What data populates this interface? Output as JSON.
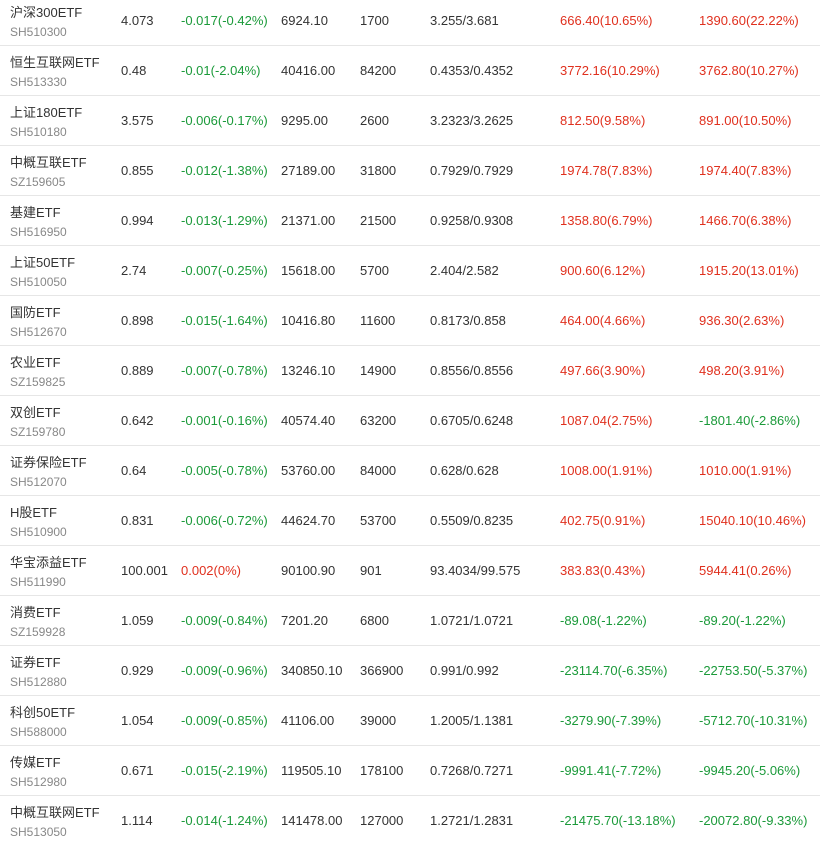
{
  "colors": {
    "up": "#e0301e",
    "down": "#1b9a3a",
    "text": "#333333",
    "code": "#888888"
  },
  "rows": [
    {
      "name": "沪深300ETF",
      "code": "SH510300",
      "price": "4.073",
      "change": "-0.017(-0.42%)",
      "change_dir": "down",
      "amount": "6924.10",
      "volume": "1700",
      "bidask": "3.255/3.681",
      "f1": "666.40(10.65%)",
      "f1_dir": "up",
      "f2": "1390.60(22.22%)",
      "f2_dir": "up"
    },
    {
      "name": "恒生互联网ETF",
      "code": "SH513330",
      "price": "0.48",
      "change": "-0.01(-2.04%)",
      "change_dir": "down",
      "amount": "40416.00",
      "volume": "84200",
      "bidask": "0.4353/0.4352",
      "f1": "3772.16(10.29%)",
      "f1_dir": "up",
      "f2": "3762.80(10.27%)",
      "f2_dir": "up"
    },
    {
      "name": "上证180ETF",
      "code": "SH510180",
      "price": "3.575",
      "change": "-0.006(-0.17%)",
      "change_dir": "down",
      "amount": "9295.00",
      "volume": "2600",
      "bidask": "3.2323/3.2625",
      "f1": "812.50(9.58%)",
      "f1_dir": "up",
      "f2": "891.00(10.50%)",
      "f2_dir": "up"
    },
    {
      "name": "中概互联ETF",
      "code": "SZ159605",
      "price": "0.855",
      "change": "-0.012(-1.38%)",
      "change_dir": "down",
      "amount": "27189.00",
      "volume": "31800",
      "bidask": "0.7929/0.7929",
      "f1": "1974.78(7.83%)",
      "f1_dir": "up",
      "f2": "1974.40(7.83%)",
      "f2_dir": "up"
    },
    {
      "name": "基建ETF",
      "code": "SH516950",
      "price": "0.994",
      "change": "-0.013(-1.29%)",
      "change_dir": "down",
      "amount": "21371.00",
      "volume": "21500",
      "bidask": "0.9258/0.9308",
      "f1": "1358.80(6.79%)",
      "f1_dir": "up",
      "f2": "1466.70(6.38%)",
      "f2_dir": "up"
    },
    {
      "name": "上证50ETF",
      "code": "SH510050",
      "price": "2.74",
      "change": "-0.007(-0.25%)",
      "change_dir": "down",
      "amount": "15618.00",
      "volume": "5700",
      "bidask": "2.404/2.582",
      "f1": "900.60(6.12%)",
      "f1_dir": "up",
      "f2": "1915.20(13.01%)",
      "f2_dir": "up"
    },
    {
      "name": "国防ETF",
      "code": "SH512670",
      "price": "0.898",
      "change": "-0.015(-1.64%)",
      "change_dir": "down",
      "amount": "10416.80",
      "volume": "11600",
      "bidask": "0.8173/0.858",
      "f1": "464.00(4.66%)",
      "f1_dir": "up",
      "f2": "936.30(2.63%)",
      "f2_dir": "up"
    },
    {
      "name": "农业ETF",
      "code": "SZ159825",
      "price": "0.889",
      "change": "-0.007(-0.78%)",
      "change_dir": "down",
      "amount": "13246.10",
      "volume": "14900",
      "bidask": "0.8556/0.8556",
      "f1": "497.66(3.90%)",
      "f1_dir": "up",
      "f2": "498.20(3.91%)",
      "f2_dir": "up"
    },
    {
      "name": "双创ETF",
      "code": "SZ159780",
      "price": "0.642",
      "change": "-0.001(-0.16%)",
      "change_dir": "down",
      "amount": "40574.40",
      "volume": "63200",
      "bidask": "0.6705/0.6248",
      "f1": "1087.04(2.75%)",
      "f1_dir": "up",
      "f2": "-1801.40(-2.86%)",
      "f2_dir": "down"
    },
    {
      "name": "证券保险ETF",
      "code": "SH512070",
      "price": "0.64",
      "change": "-0.005(-0.78%)",
      "change_dir": "down",
      "amount": "53760.00",
      "volume": "84000",
      "bidask": "0.628/0.628",
      "f1": "1008.00(1.91%)",
      "f1_dir": "up",
      "f2": "1010.00(1.91%)",
      "f2_dir": "up"
    },
    {
      "name": "H股ETF",
      "code": "SH510900",
      "price": "0.831",
      "change": "-0.006(-0.72%)",
      "change_dir": "down",
      "amount": "44624.70",
      "volume": "53700",
      "bidask": "0.5509/0.8235",
      "f1": "402.75(0.91%)",
      "f1_dir": "up",
      "f2": "15040.10(10.46%)",
      "f2_dir": "up"
    },
    {
      "name": "华宝添益ETF",
      "code": "SH511990",
      "price": "100.001",
      "change": "0.002(0%)",
      "change_dir": "up",
      "amount": "90100.90",
      "volume": "901",
      "bidask": "93.4034/99.575",
      "f1": "383.83(0.43%)",
      "f1_dir": "up",
      "f2": "5944.41(0.26%)",
      "f2_dir": "up"
    },
    {
      "name": "消费ETF",
      "code": "SZ159928",
      "price": "1.059",
      "change": "-0.009(-0.84%)",
      "change_dir": "down",
      "amount": "7201.20",
      "volume": "6800",
      "bidask": "1.0721/1.0721",
      "f1": "-89.08(-1.22%)",
      "f1_dir": "down",
      "f2": "-89.20(-1.22%)",
      "f2_dir": "down"
    },
    {
      "name": "证券ETF",
      "code": "SH512880",
      "price": "0.929",
      "change": "-0.009(-0.96%)",
      "change_dir": "down",
      "amount": "340850.10",
      "volume": "366900",
      "bidask": "0.991/0.992",
      "f1": "-23114.70(-6.35%)",
      "f1_dir": "down",
      "f2": "-22753.50(-5.37%)",
      "f2_dir": "down"
    },
    {
      "name": "科创50ETF",
      "code": "SH588000",
      "price": "1.054",
      "change": "-0.009(-0.85%)",
      "change_dir": "down",
      "amount": "41106.00",
      "volume": "39000",
      "bidask": "1.2005/1.1381",
      "f1": "-3279.90(-7.39%)",
      "f1_dir": "down",
      "f2": "-5712.70(-10.31%)",
      "f2_dir": "down"
    },
    {
      "name": "传媒ETF",
      "code": "SH512980",
      "price": "0.671",
      "change": "-0.015(-2.19%)",
      "change_dir": "down",
      "amount": "119505.10",
      "volume": "178100",
      "bidask": "0.7268/0.7271",
      "f1": "-9991.41(-7.72%)",
      "f1_dir": "down",
      "f2": "-9945.20(-5.06%)",
      "f2_dir": "down"
    },
    {
      "name": "中概互联网ETF",
      "code": "SH513050",
      "price": "1.114",
      "change": "-0.014(-1.24%)",
      "change_dir": "down",
      "amount": "141478.00",
      "volume": "127000",
      "bidask": "1.2721/1.2831",
      "f1": "-21475.70(-13.18%)",
      "f1_dir": "down",
      "f2": "-20072.80(-9.33%)",
      "f2_dir": "down"
    }
  ]
}
